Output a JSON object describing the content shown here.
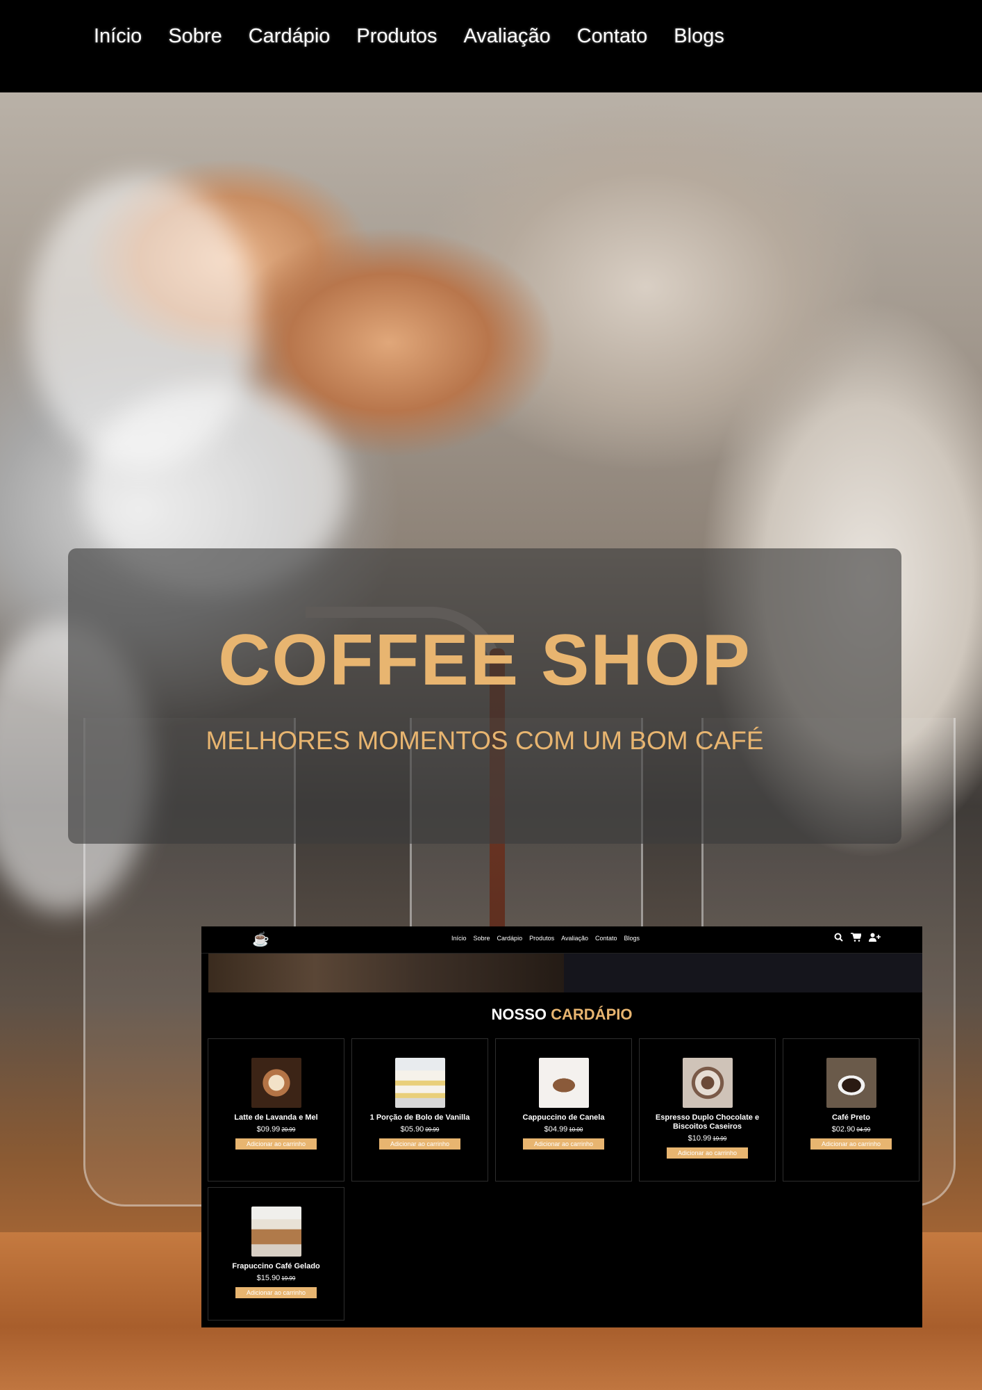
{
  "nav": {
    "items": [
      "Início",
      "Sobre",
      "Cardápio",
      "Produtos",
      "Avaliação",
      "Contato",
      "Blogs"
    ]
  },
  "hero": {
    "title": "COFFEE SHOP",
    "subtitle": "MELHORES MOMENTOS COM UM BOM CAFÉ"
  },
  "preview": {
    "logo_icon": "coffee-cup-icon",
    "nav_items": [
      "Início",
      "Sobre",
      "Cardápio",
      "Produtos",
      "Avaliação",
      "Contato",
      "Blogs"
    ],
    "icons": [
      "search-icon",
      "cart-icon",
      "add-user-icon"
    ],
    "section_title_prefix": "NOSSO",
    "section_title_accent": "CARDÁPIO",
    "products": [
      {
        "name": "Latte de Lavanda e Mel",
        "price": "$09.99",
        "old_price": "20.99",
        "button": "Adicionar ao carrinho"
      },
      {
        "name": "1 Porção de Bolo de Vanilla",
        "price": "$05.90",
        "old_price": "09.99",
        "button": "Adicionar ao carrinho"
      },
      {
        "name": "Cappuccino de Canela",
        "price": "$04.99",
        "old_price": "10.00",
        "button": "Adicionar ao carrinho"
      },
      {
        "name": "Espresso Duplo Chocolate e Biscoitos Caseiros",
        "price": "$10.99",
        "old_price": "19.99",
        "button": "Adicionar ao carrinho"
      },
      {
        "name": "Café Preto",
        "price": "$02.90",
        "old_price": "04.99",
        "button": "Adicionar ao carrinho"
      },
      {
        "name": "Frapuccino Café Gelado",
        "price": "$15.90",
        "old_price": "19.99",
        "button": "Adicionar ao carrinho"
      }
    ]
  },
  "colors": {
    "accent": "#e8b570",
    "background": "#000000"
  }
}
